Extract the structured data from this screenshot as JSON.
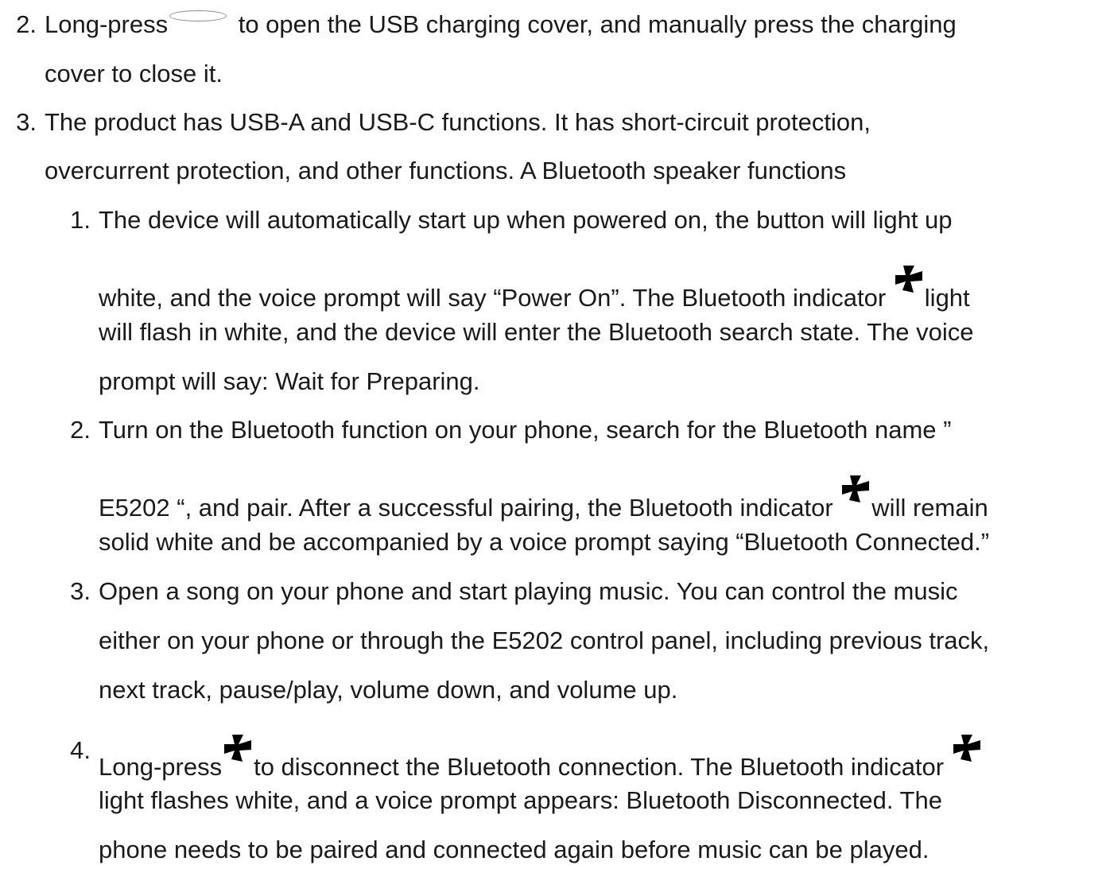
{
  "list_items": [
    {
      "number": "2.",
      "lines": [
        {
          "before": "Long-press",
          "icon": "oval-button-icon",
          "after": " to open the USB charging cover, and manually press the charging"
        },
        {
          "text": "cover to close it."
        }
      ]
    },
    {
      "number": "3.",
      "lines": [
        {
          "text": "The product has USB-A and USB-C functions. It has short-circuit protection,"
        },
        {
          "text": "overcurrent protection, and other functions. A Bluetooth speaker functions"
        }
      ]
    }
  ],
  "sub_items": [
    {
      "number": "1.",
      "lines": [
        {
          "text": "The device will automatically start up when powered on, the button will light up"
        },
        {
          "before": "white, and the voice prompt will say “Power On”. The Bluetooth indicator ",
          "icon": "bluetooth-icon",
          "after": "light"
        },
        {
          "text": "will flash in white, and the device will enter the Bluetooth search state. The voice"
        },
        {
          "text": "prompt will say: Wait for Preparing."
        }
      ]
    },
    {
      "number": "2.",
      "lines": [
        {
          "text": "Turn on the Bluetooth function on your phone, search for the Bluetooth name ”"
        },
        {
          "before": "E5202 “, and pair. After a successful pairing, the Bluetooth indicator ",
          "icon": "bluetooth-icon",
          "after": "will remain"
        },
        {
          "text": "solid white and be accompanied by a voice prompt saying “Bluetooth Connected.”"
        }
      ]
    },
    {
      "number": "3.",
      "lines": [
        {
          "text": "Open a song on your phone and start playing music. You can control the music"
        },
        {
          "text": "either on your phone or through the E5202 control panel, including previous track,"
        },
        {
          "text": "next track, pause/play, volume down, and volume up."
        }
      ]
    },
    {
      "number": "4.",
      "lines": [
        {
          "before": " Long-press",
          "icon": "bluetooth-icon",
          "after": "to disconnect the Bluetooth connection. The Bluetooth indicator ",
          "icon2": "bluetooth-icon"
        },
        {
          "text": "light flashes white, and a voice prompt appears: Bluetooth Disconnected. The"
        },
        {
          "text": "phone needs to be paired and connected again before music can be played."
        }
      ]
    }
  ],
  "colors": {
    "text": "#1a1a1a",
    "icon": "#000000",
    "oval_outline": "#8a8a8a"
  }
}
